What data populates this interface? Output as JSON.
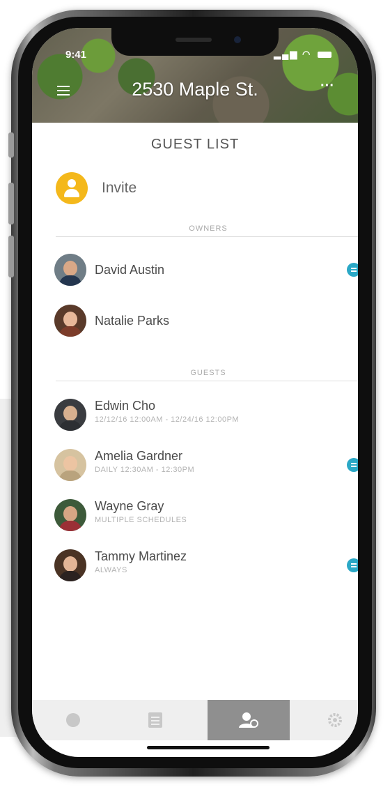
{
  "status_bar": {
    "time": "9:41"
  },
  "header": {
    "title": "2530 Maple St.",
    "more_label": "···"
  },
  "page_title": "GUEST LIST",
  "invite": {
    "label": "Invite",
    "icon": "person-add-icon"
  },
  "sections": {
    "owners_label": "OWNERS",
    "guests_label": "GUESTS"
  },
  "owners": [
    {
      "name": "David Austin",
      "badge": true
    },
    {
      "name": "Natalie Parks",
      "badge": false
    }
  ],
  "guests": [
    {
      "name": "Edwin Cho",
      "schedule": "12/12/16 12:00AM - 12/24/16 12:00PM",
      "badge": false
    },
    {
      "name": "Amelia Gardner",
      "schedule": "DAILY 12:30AM - 12:30PM",
      "badge": true
    },
    {
      "name": "Wayne Gray",
      "schedule": "MULTIPLE SCHEDULES",
      "badge": false
    },
    {
      "name": "Tammy Martinez",
      "schedule": "ALWAYS",
      "badge": true
    }
  ],
  "tabbar": {
    "tabs": [
      {
        "icon": "lock-circle-icon",
        "active": false
      },
      {
        "icon": "history-list-icon",
        "active": false
      },
      {
        "icon": "guests-icon",
        "active": true
      },
      {
        "icon": "settings-gear-icon",
        "active": false
      }
    ]
  },
  "colors": {
    "accent_yellow": "#f4b81b",
    "badge_blue": "#2aa8c6",
    "active_tab": "#8f8f8f"
  }
}
